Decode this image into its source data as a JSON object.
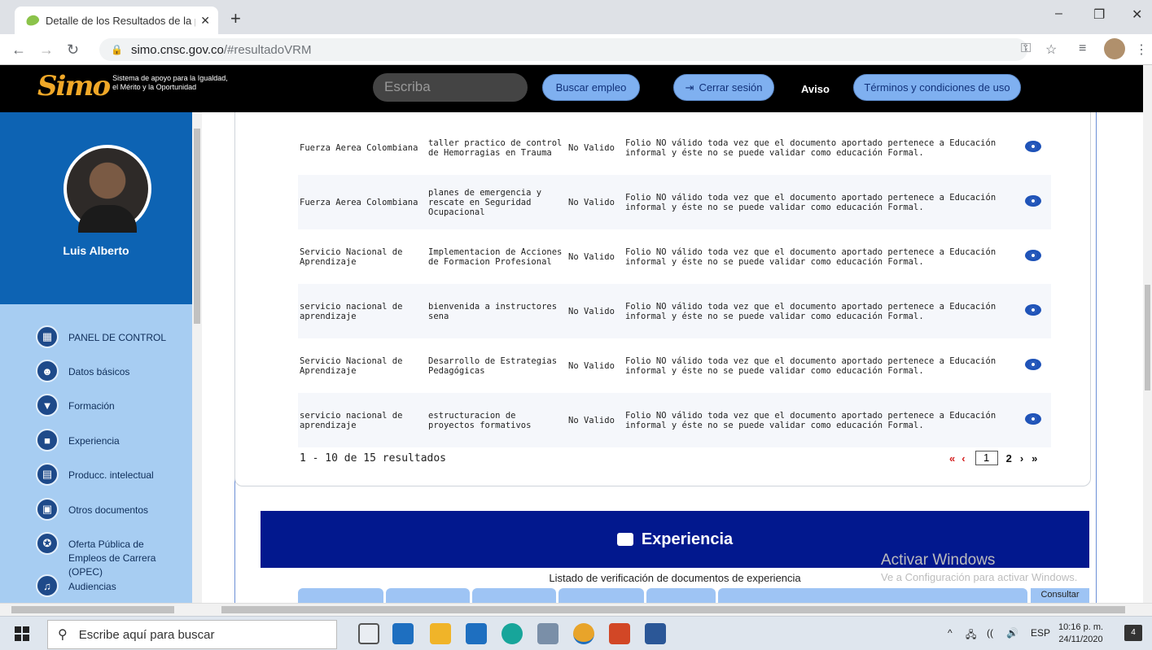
{
  "browser": {
    "tab_title": "Detalle de los Resultados de la p",
    "tab_close": "✕",
    "new_tab": "+",
    "url_host": "simo.cnsc.gov.co",
    "url_path": "/#resultadoVRM",
    "window_controls": [
      "–",
      "❐",
      "✕"
    ]
  },
  "site_header": {
    "logo_text": "Simo",
    "logo_tagline_1": "Sistema de apoyo para la Igualdad,",
    "logo_tagline_2": "el Mérito y la Oportunidad",
    "search_placeholder": "Escriba",
    "buscar_empleo": "Buscar empleo",
    "cerrar_sesion": "Cerrar sesión",
    "aviso": "Aviso",
    "terminos": "Términos y condiciones de uso"
  },
  "sidebar": {
    "user_name": "Luis Alberto",
    "items": [
      {
        "label": "PANEL DE CONTROL",
        "icon": "dashboard-icon"
      },
      {
        "label": "Datos básicos",
        "icon": "people-icon"
      },
      {
        "label": "Formación",
        "icon": "education-icon"
      },
      {
        "label": "Experiencia",
        "icon": "briefcase-icon"
      },
      {
        "label": "Producc. intelectual",
        "icon": "book-icon"
      },
      {
        "label": "Otros documentos",
        "icon": "document-icon"
      },
      {
        "label": "Oferta Pública de",
        "label2": "Empleos de Carrera (OPEC)",
        "icon": "globe-icon"
      },
      {
        "label": "Audiencias",
        "icon": "audience-icon"
      }
    ]
  },
  "results": {
    "rows": [
      {
        "entity": "Fuerza Aerea Colombiana",
        "program": "taller practico de control de Hemorragias en Trauma",
        "status": "No Valido",
        "observation": "Folio NO válido toda vez que el documento aportado pertenece a Educación informal y éste no se puede validar como educación Formal."
      },
      {
        "entity": "Fuerza Aerea Colombiana",
        "program": "planes de emergencia y rescate en Seguridad Ocupacional",
        "status": "No Valido",
        "observation": "Folio NO válido toda vez que el documento aportado pertenece a Educación informal y éste no se puede validar como educación Formal."
      },
      {
        "entity": "Servicio Nacional de Aprendizaje",
        "program": "Implementacion de Acciones de Formacion Profesional",
        "status": "No Valido",
        "observation": "Folio NO válido toda vez que el documento aportado pertenece a Educación informal y éste no se puede validar como educación Formal."
      },
      {
        "entity": "servicio nacional de aprendizaje",
        "program": "bienvenida a instructores sena",
        "status": "No Valido",
        "observation": "Folio NO válido toda vez que el documento aportado pertenece a Educación informal y éste no se puede validar como educación Formal."
      },
      {
        "entity": "Servicio Nacional de Aprendizaje",
        "program": "Desarrollo de Estrategias Pedagógicas",
        "status": "No Valido",
        "observation": "Folio NO válido toda vez que el documento aportado pertenece a Educación informal y éste no se puede validar como educación Formal."
      },
      {
        "entity": "servicio nacional de aprendizaje",
        "program": "estructuracion de proyectos formativos",
        "status": "No Valido",
        "observation": "Folio NO válido toda vez que el documento aportado pertenece a Educación informal y éste no se puede validar como educación Formal."
      }
    ],
    "count_text": "1 - 10 de 15 resultados",
    "pager": {
      "first": "«",
      "prev": "‹",
      "current": "1",
      "next_page": "2",
      "next": "›",
      "last": "»"
    }
  },
  "experiencia": {
    "title": "Experiencia",
    "subtitle": "Listado de verificación de documentos de experiencia",
    "consultar": "Consultar"
  },
  "watermark": {
    "line1": "Activar Windows",
    "line2": "Ve a Configuración para activar Windows."
  },
  "taskbar": {
    "search_placeholder": "Escribe aquí para buscar",
    "lang": "ESP",
    "time": "10:16 p. m.",
    "date": "24/11/2020",
    "notifications": "4"
  }
}
